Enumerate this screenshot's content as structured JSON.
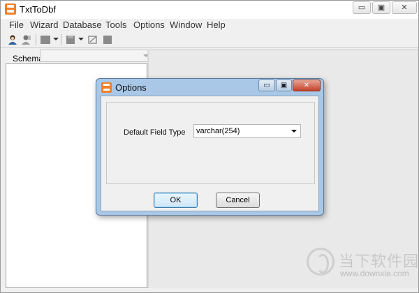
{
  "app": {
    "title": "TxtToDbf"
  },
  "window_controls": {
    "minimize": "▭",
    "maximize": "▣",
    "close": "✕"
  },
  "menu": [
    "File",
    "Wizard",
    "Database",
    "Tools",
    "Options",
    "Window",
    "Help"
  ],
  "toolbar": {
    "icons": [
      "connect-icon",
      "disconnect-icon",
      "open-icon",
      "save-icon",
      "wizard-icon",
      "properties-icon"
    ]
  },
  "schema": {
    "label": "Schema",
    "value": ""
  },
  "dialog": {
    "title": "Options",
    "controls": {
      "minimize": "▭",
      "maximize": "▣",
      "close": "✕"
    },
    "field_label": "Default Field Type",
    "field_value": "varchar(254)",
    "ok_label": "OK",
    "cancel_label": "Cancel"
  },
  "watermark": {
    "text": "当下软件园",
    "url": "www.downxia.com"
  },
  "colors": {
    "accent": "#f0802a",
    "dialog_frame": "#a9c8e8"
  }
}
